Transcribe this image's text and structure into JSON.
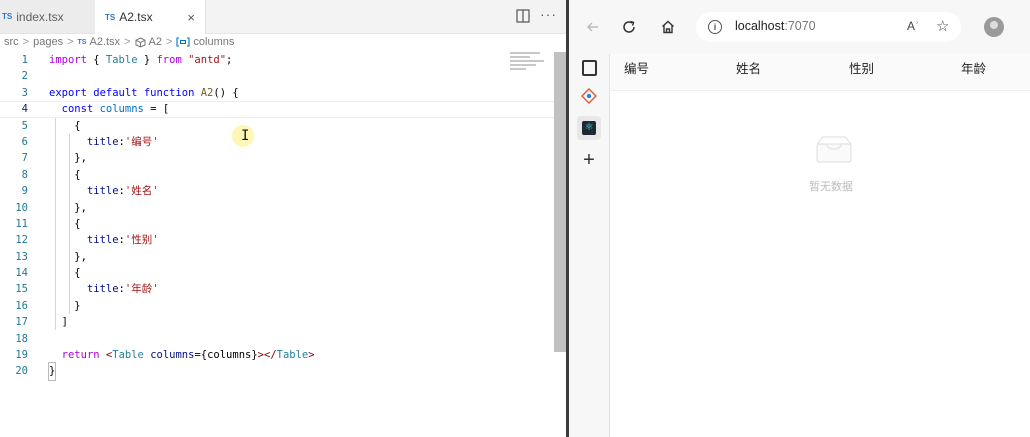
{
  "editor": {
    "tabs": [
      {
        "badge": "TS",
        "label": "index.tsx"
      },
      {
        "badge": "TS",
        "label": "A2.tsx",
        "close": "×"
      }
    ],
    "more": "···",
    "breadcrumb": {
      "parts": [
        "src",
        "pages"
      ],
      "file_badge": "TS",
      "file": "A2.tsx",
      "symbol": "A2",
      "variable": "columns",
      "separator": ">"
    },
    "line_numbers": [
      "1",
      "2",
      "3",
      "4",
      "5",
      "6",
      "7",
      "8",
      "9",
      "10",
      "11",
      "12",
      "13",
      "14",
      "15",
      "16",
      "17",
      "18",
      "19",
      "20"
    ],
    "code": {
      "l1": {
        "kw": "import",
        "p1": " { ",
        "ty": "Table",
        "p2": " } ",
        "kw2": "from",
        "str": "\"antd\"",
        "end": ";"
      },
      "l3": {
        "kw": "export default function",
        "fn": "A2",
        "end": "() {"
      },
      "l4": {
        "kw": "const",
        "var": "columns",
        "end": " = ["
      },
      "open_brace": "{",
      "close_brace": "},",
      "last_close_brace": "}",
      "prop": "title",
      "titles": [
        "'编号'",
        "'姓名'",
        "'性别'",
        "'年龄'"
      ],
      "l17": "]",
      "l19": {
        "ctl": "return",
        "t1": "<",
        "ty": "Table",
        "attr": "columns",
        "expr": "={columns}",
        "t2": "></",
        "ty2": "Table",
        "t3": ">"
      },
      "l20": "}"
    },
    "text_cursor": "I"
  },
  "browser": {
    "url_host": "localhost",
    "url_port": ":7070",
    "read_aloud": "Aʾ",
    "table": {
      "columns": [
        "编号",
        "姓名",
        "性别",
        "年龄"
      ],
      "empty_text": "暂无数据"
    }
  },
  "icons": [
    "tab-actions-icon",
    "refresh-icon",
    "home-icon",
    "back-icon",
    "info-icon",
    "favorite-icon",
    "profile-icon",
    "tabs-icon",
    "copilot-icon",
    "react-devtools-icon",
    "add-icon",
    "empty-box-icon",
    "split-editor-icon",
    "more-icon"
  ]
}
